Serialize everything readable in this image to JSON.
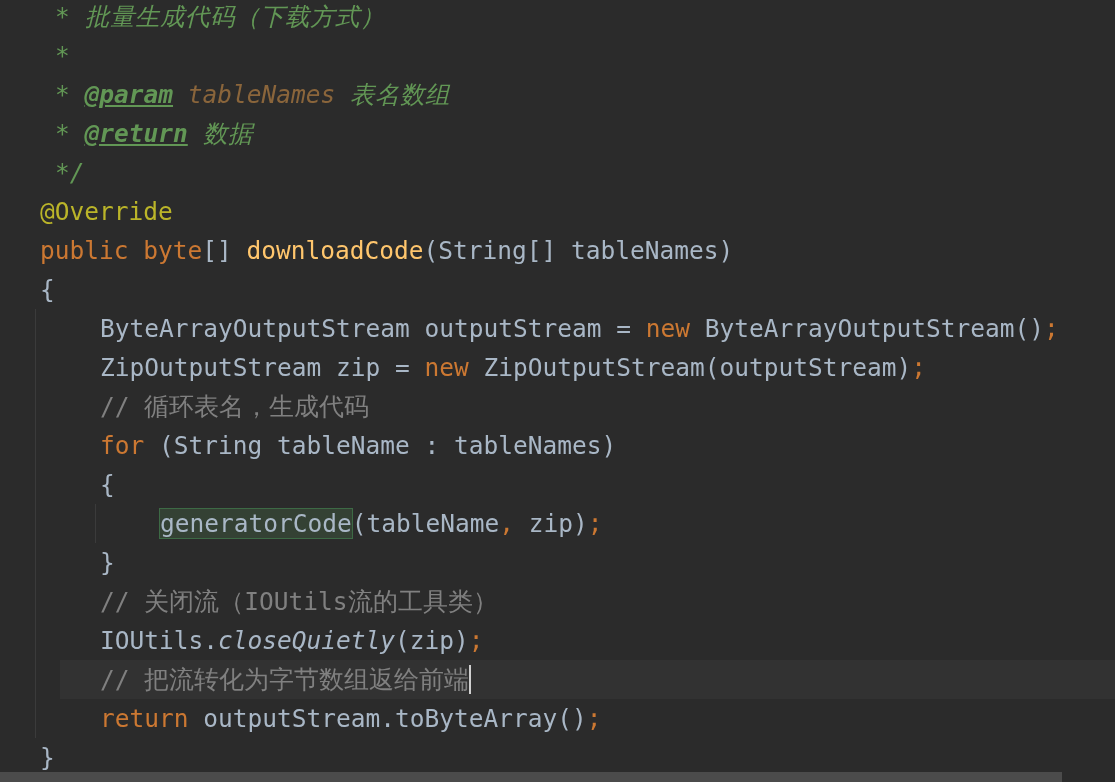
{
  "editor": {
    "lines": [
      {
        "tokens": [
          {
            "kind": "doc",
            "text": "* 批量生成代码（下载方式）"
          }
        ]
      },
      {
        "tokens": [
          {
            "kind": "doc",
            "text": "*"
          }
        ]
      },
      {
        "tokens": [
          {
            "kind": "doc",
            "text": "* "
          },
          {
            "kind": "doc-tag",
            "text": "@param"
          },
          {
            "kind": "doc-param",
            "text": " tableNames"
          },
          {
            "kind": "doc",
            "text": " 表名数组"
          }
        ]
      },
      {
        "tokens": [
          {
            "kind": "doc",
            "text": "* "
          },
          {
            "kind": "doc-tag",
            "text": "@return"
          },
          {
            "kind": "doc",
            "text": " 数据"
          }
        ]
      },
      {
        "tokens": [
          {
            "kind": "doc",
            "text": "*/"
          }
        ]
      },
      {
        "tokens": [
          {
            "kind": "annotation",
            "text": "@Override"
          }
        ]
      },
      {
        "tokens": [
          {
            "kind": "keyword",
            "text": "public byte"
          },
          {
            "kind": "plain",
            "text": "[] "
          },
          {
            "kind": "method",
            "text": "downloadCode"
          },
          {
            "kind": "plain",
            "text": "(String[] tableNames)"
          }
        ]
      },
      {
        "tokens": [
          {
            "kind": "plain",
            "text": "{"
          }
        ],
        "children": [
          {
            "tokens": [
              {
                "kind": "plain",
                "text": "ByteArrayOutputStream outputStream = "
              },
              {
                "kind": "keyword",
                "text": "new"
              },
              {
                "kind": "plain",
                "text": " ByteArrayOutputStream()"
              },
              {
                "kind": "keyword",
                "text": ";"
              }
            ]
          },
          {
            "tokens": [
              {
                "kind": "plain",
                "text": "ZipOutputStream zip = "
              },
              {
                "kind": "keyword",
                "text": "new"
              },
              {
                "kind": "plain",
                "text": " ZipOutputStream(outputStream)"
              },
              {
                "kind": "keyword",
                "text": ";"
              }
            ]
          },
          {
            "tokens": [
              {
                "kind": "comment",
                "text": "// 循环表名，生成代码"
              }
            ]
          },
          {
            "tokens": [
              {
                "kind": "keyword",
                "text": "for"
              },
              {
                "kind": "plain",
                "text": " (String tableName : tableNames)"
              }
            ]
          },
          {
            "tokens": [
              {
                "kind": "plain",
                "text": "{"
              }
            ],
            "children": [
              {
                "tokens": [
                  {
                    "kind": "usage",
                    "text": "generatorCode"
                  },
                  {
                    "kind": "plain",
                    "text": "(tableName"
                  },
                  {
                    "kind": "keyword",
                    "text": ","
                  },
                  {
                    "kind": "plain",
                    "text": " zip)"
                  },
                  {
                    "kind": "keyword",
                    "text": ";"
                  }
                ]
              }
            ]
          },
          {
            "tokens": [
              {
                "kind": "plain",
                "text": "}"
              }
            ]
          },
          {
            "tokens": [
              {
                "kind": "comment",
                "text": "// 关闭流（IOUtils流的工具类）"
              }
            ]
          },
          {
            "tokens": [
              {
                "kind": "plain",
                "text": "IOUtils."
              },
              {
                "kind": "static",
                "text": "closeQuietly"
              },
              {
                "kind": "plain",
                "text": "(zip)"
              },
              {
                "kind": "keyword",
                "text": ";"
              }
            ]
          },
          {
            "current": true,
            "tokens": [
              {
                "kind": "comment",
                "text": "// 把流转化为字节数组返给前端"
              }
            ]
          },
          {
            "tokens": [
              {
                "kind": "keyword",
                "text": "return"
              },
              {
                "kind": "plain",
                "text": " outputStream.toByteArray()"
              },
              {
                "kind": "keyword",
                "text": ";"
              }
            ]
          }
        ]
      },
      {
        "tokens": [
          {
            "kind": "plain",
            "text": "}"
          }
        ]
      }
    ]
  }
}
